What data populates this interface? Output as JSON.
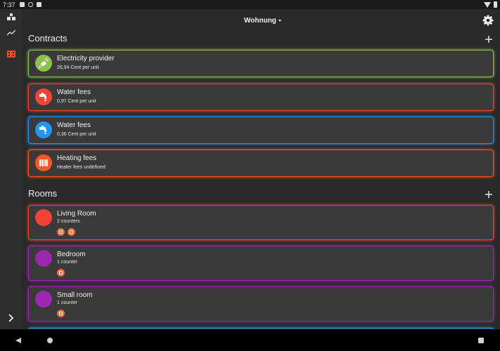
{
  "status_bar": {
    "time": "7:37"
  },
  "header": {
    "home_name": "Wohnung"
  },
  "contracts": {
    "title": "Contracts",
    "items": [
      {
        "title": "Electricity provider",
        "subtitle": "26,94 Cent per unit",
        "color": "#8bc34a",
        "icon": "plug-icon"
      },
      {
        "title": "Water fees",
        "subtitle": "0,97 Cent per unit",
        "color": "#f44336",
        "icon": "hot-water-tap-icon"
      },
      {
        "title": "Water fees",
        "subtitle": "0,36 Cent per unit",
        "color": "#2196f3",
        "icon": "cold-water-tap-icon"
      },
      {
        "title": "Heating fees",
        "subtitle": "Heater fees undefined",
        "color": "#ff5722",
        "icon": "radiator-icon"
      }
    ]
  },
  "rooms": {
    "title": "Rooms",
    "items": [
      {
        "title": "Living Room",
        "subtitle": "2 counters",
        "color": "#f44336",
        "counters": 2
      },
      {
        "title": "Bedroom",
        "subtitle": "1 counter",
        "color": "#9c27b0",
        "counters": 1
      },
      {
        "title": "Small room",
        "subtitle": "1 counter",
        "color": "#9c27b0",
        "counters": 1
      }
    ]
  },
  "theme": {
    "accent": "#f26b3a",
    "background": "#2a2a2a",
    "card": "#3a3a3a"
  }
}
